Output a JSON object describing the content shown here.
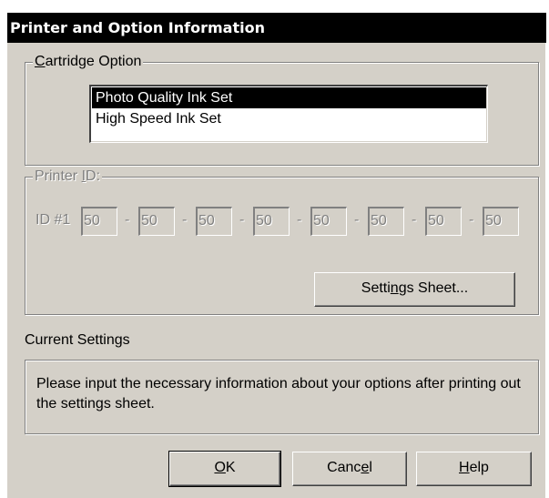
{
  "window": {
    "title": "Printer and Option Information"
  },
  "cartridge": {
    "legend_accel": "C",
    "legend_rest": "artridge Option",
    "items": [
      {
        "label": "Photo Quality Ink Set",
        "selected": true
      },
      {
        "label": "High Speed Ink Set",
        "selected": false
      }
    ]
  },
  "printer_id": {
    "legend_prefix": "Printer ",
    "legend_accel": "I",
    "legend_suffix": "D:",
    "id_label": "ID #1",
    "separator": "-",
    "fields": [
      "50",
      "50",
      "50",
      "50",
      "50",
      "50",
      "50",
      "50"
    ],
    "settings_button": {
      "pre": "Setti",
      "accel": "n",
      "post": "gs Sheet..."
    }
  },
  "current_settings": {
    "label": "Current Settings",
    "message": "Please input the necessary information about your options after printing out the settings sheet."
  },
  "buttons": {
    "ok": {
      "accel": "O",
      "post": "K"
    },
    "cancel": {
      "pre": "Canc",
      "accel": "e",
      "post": "l"
    },
    "help": {
      "accel": "H",
      "post": "elp"
    }
  }
}
